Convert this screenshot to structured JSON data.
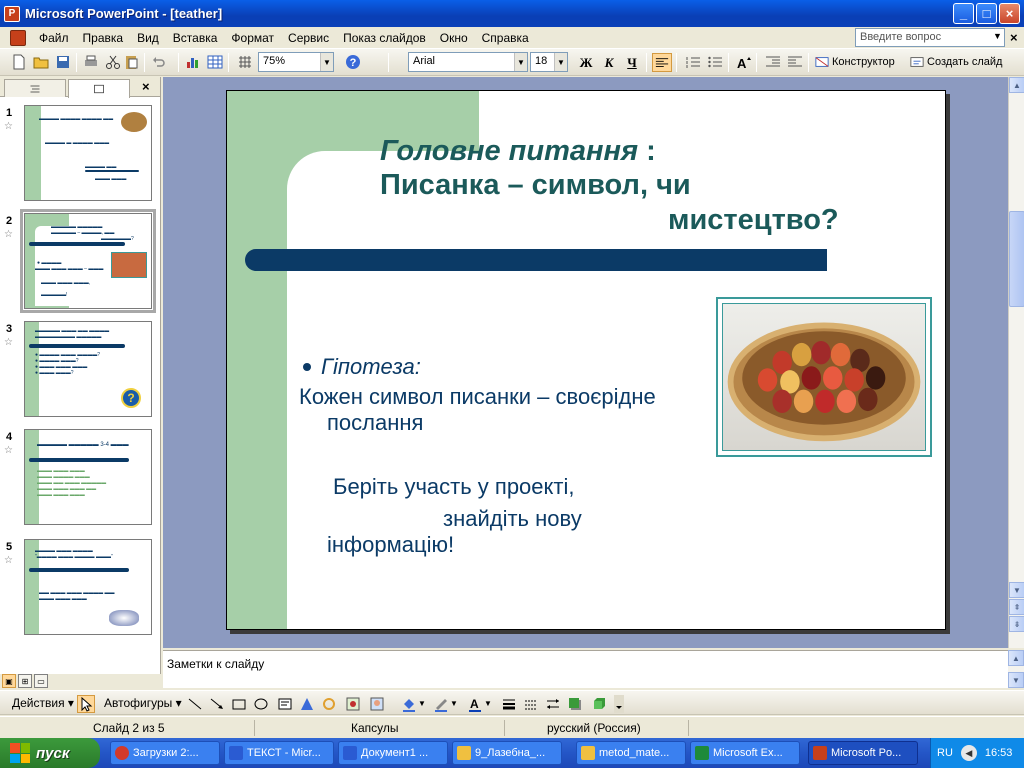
{
  "window": {
    "title": "Microsoft PowerPoint - [teather]",
    "min": "_",
    "max": "□",
    "close": "×"
  },
  "menu": {
    "items": [
      "Файл",
      "Правка",
      "Вид",
      "Вставка",
      "Формат",
      "Сервис",
      "Показ слайдов",
      "Окно",
      "Справка"
    ],
    "question_placeholder": "Введите вопрос",
    "doc_close": "×"
  },
  "toolbar": {
    "zoom": "75%",
    "font": "Arial",
    "size": "18",
    "bold": "Ж",
    "italic": "К",
    "underline": "Ч",
    "designer": "Конструктор",
    "new_slide": "Создать слайд",
    "help_icon": "?"
  },
  "slides_pane": {
    "tabs": [
      "outline",
      "slides"
    ],
    "close": "×",
    "thumbs": [
      {
        "num": "1",
        "star": "☆"
      },
      {
        "num": "2",
        "star": "☆"
      },
      {
        "num": "3",
        "star": "☆"
      },
      {
        "num": "4",
        "star": "☆"
      },
      {
        "num": "5",
        "star": "☆"
      }
    ]
  },
  "slide": {
    "title_italic": "Головне питання",
    "title_colon": " :",
    "title_line2": "Писанка – символ, чи",
    "title_line3": "мистецтво?",
    "bullet": "Гіпотеза:",
    "body1": "Кожен символ писанки – своєрідне",
    "body2": "послання",
    "body3": "Беріть участь у проекті,",
    "body4": "знайдіть нову",
    "body5": "інформацію!"
  },
  "notes": {
    "text": "Заметки к слайду"
  },
  "drawbar": {
    "actions": "Действия",
    "autoshapes": "Автофигуры"
  },
  "status": {
    "slide": "Слайд 2 из 5",
    "design": "Капсулы",
    "lang": "русский (Россия)"
  },
  "taskbar": {
    "start": "пуск",
    "tasks": [
      {
        "label": "Загрузки 2:...",
        "color": "#d23a2a"
      },
      {
        "label": "ТЕКСТ - Micr...",
        "color": "#2a5bd2"
      },
      {
        "label": "Документ1 ...",
        "color": "#2a5bd2"
      },
      {
        "label": "9_Лазебна_...",
        "color": "#f0c040"
      },
      {
        "label": "metod_mate...",
        "color": "#f0c040"
      },
      {
        "label": "Microsoft Ex...",
        "color": "#1e8a3a"
      },
      {
        "label": "Microsoft Po...",
        "color": "#c6401a"
      }
    ],
    "lang": "RU",
    "time": "16:53"
  }
}
